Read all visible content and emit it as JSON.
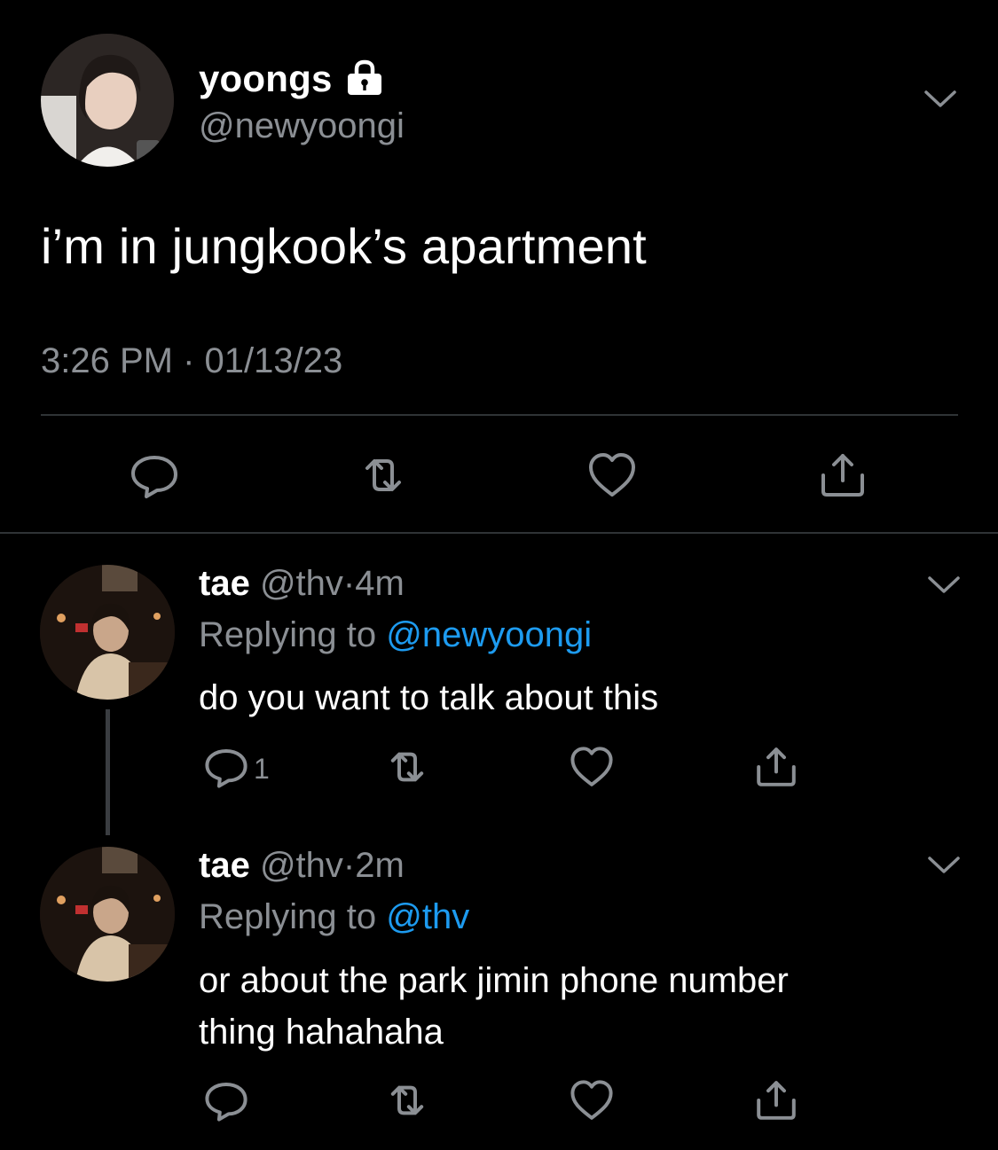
{
  "colors": {
    "background": "#000000",
    "primary_text": "#ffffff",
    "secondary_text": "#8b8f94",
    "mention": "#1d9bf0",
    "divider": "#2f3336"
  },
  "main_tweet": {
    "display_name": "yoongs",
    "handle": "@newyoongi",
    "protected_icon": "lock-icon",
    "text": "i’m in jungkook’s apartment",
    "time": "3:26 PM",
    "separator": "·",
    "date": "01/13/23",
    "actions": [
      "reply-icon",
      "retweet-icon",
      "like-icon",
      "share-icon"
    ]
  },
  "replies": [
    {
      "display_name": "tae",
      "handle": "@thv",
      "dot": "·",
      "age": "4m",
      "replying_prefix": "Replying to",
      "replying_to": "@newyoongi",
      "text": "do you want to talk about this",
      "reply_count": "1"
    },
    {
      "display_name": "tae",
      "handle": "@thv",
      "dot": "·",
      "age": "2m",
      "replying_prefix": "Replying to",
      "replying_to": "@thv",
      "text_line1": "or about the park jimin phone number",
      "text_line2": "thing hahahaha"
    }
  ]
}
